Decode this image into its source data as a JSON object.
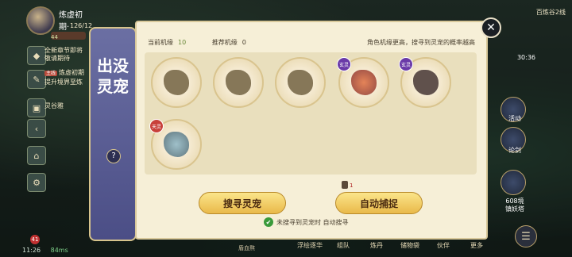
{
  "player": {
    "name": "炼虚初期·",
    "level": "126/12",
    "xp_badge": "44"
  },
  "quests": [
    {
      "tag": "",
      "text": "全新章节即将"
    },
    {
      "tag": "",
      "text": "敬请期待"
    },
    {
      "tag": "主线",
      "text": "炼虚初期"
    },
    {
      "tag": "",
      "text": "提升境界至炼"
    },
    {
      "tag": "",
      "text": "灵谷雅"
    }
  ],
  "status": {
    "time": "11:26",
    "latency": "84ms",
    "chat_unread": "41"
  },
  "map": {
    "location": "百炼谷2线",
    "time": "30:36"
  },
  "right_buttons": [
    "活动",
    "论剑",
    "608境",
    "镇妖塔"
  ],
  "bottom_menu": [
    "浮绘逐华",
    "组队",
    "炼丹",
    "储物袋",
    "伙伴",
    "更多"
  ],
  "bottom_extra": "盾血熬",
  "dialog": {
    "title": "出没灵宠",
    "help_icon": "?",
    "current_label": "当前机缘",
    "current_value": "10",
    "recommended_label": "推荐机缘",
    "recommended_value": "0",
    "hint": "角色机缘更高，搜寻到灵宠的概率越高",
    "close": "✕",
    "pets": [
      {
        "revealed": false,
        "rank": ""
      },
      {
        "revealed": false,
        "rank": ""
      },
      {
        "revealed": false,
        "rank": ""
      },
      {
        "revealed": true,
        "rank": "玄灵",
        "fire": true
      },
      {
        "revealed": true,
        "rank": "玄灵",
        "fire": false
      },
      {
        "revealed": true,
        "rank": "天灵",
        "fire": false
      }
    ],
    "coin_count": "1",
    "search_button": "搜寻灵宠",
    "auto_capture_button": "自动捕捉",
    "auto_search_text": "未搜寻到灵宠时 自动搜寻",
    "auto_check": "✔"
  }
}
